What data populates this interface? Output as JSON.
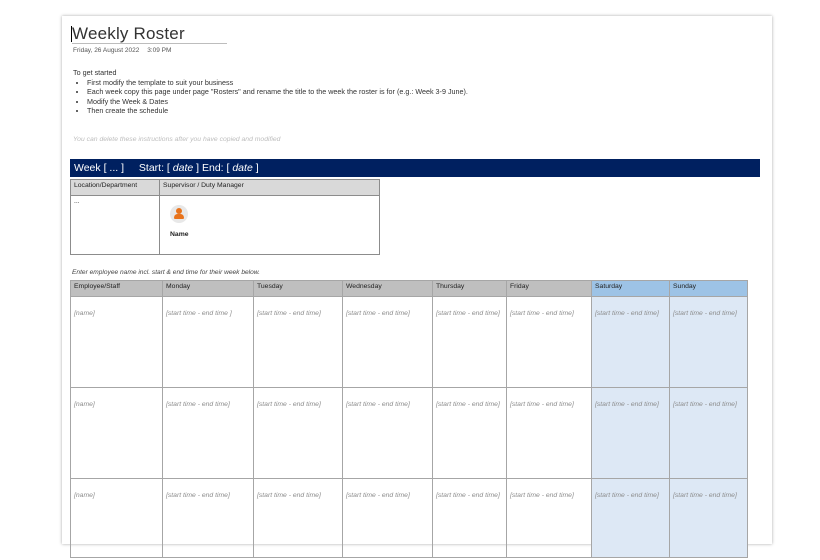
{
  "title": "Weekly Roster",
  "date": "Friday, 26 August 2022",
  "time": "3:09 PM",
  "intro": {
    "heading": "To get started",
    "bullets": [
      "First modify the template to suit your business",
      "Each week copy this page under page \"Rosters\" and rename the title to the week the roster is for (e.g.: Week 3-9 June).",
      "Modify the Week & Dates",
      "Then create the schedule"
    ],
    "note": "You can delete these instructions after you have copied and modified"
  },
  "week_bar": {
    "week": "Week [ ... ]",
    "start_label": "Start: [",
    "start_value": "date",
    "end_label": "] End: [",
    "end_value": "date",
    "close": "]"
  },
  "location_table": {
    "headers": [
      "Location/Department",
      "Supervisor / Duty Manager"
    ],
    "location_value": "...",
    "supervisor_name": "Name"
  },
  "roster_instruction": "Enter employee name incl. start & end time for their week below.",
  "roster": {
    "headers": [
      "Employee/Staff",
      "Monday",
      "Tuesday",
      "Wednesday",
      "Thursday",
      "Friday",
      "Saturday",
      "Sunday"
    ],
    "rows": [
      [
        "[name]",
        "[start time - end time ]",
        "[start time - end time]",
        "[start time - end time]",
        "[start time - end time]",
        "[start time - end time]",
        "[start time - end time]",
        "[start time - end time]"
      ],
      [
        "[name]",
        "[start time - end time]",
        "[start time - end time]",
        "[start time - end time]",
        "[start time - end time]",
        "[start time - end time]",
        "[start time - end time]",
        "[start time - end time]"
      ],
      [
        "[name]",
        "[start time - end time]",
        "[start time - end time]",
        "[start time - end time]",
        "[start time - end time]",
        "[start time - end time]",
        "[start time - end time]",
        "[start time - end time]"
      ]
    ]
  },
  "colors": {
    "week_bar": "#002060",
    "weekend_header": "#9dc3e6",
    "weekend_cell": "#dde8f5",
    "avatar": "#e8731c"
  }
}
